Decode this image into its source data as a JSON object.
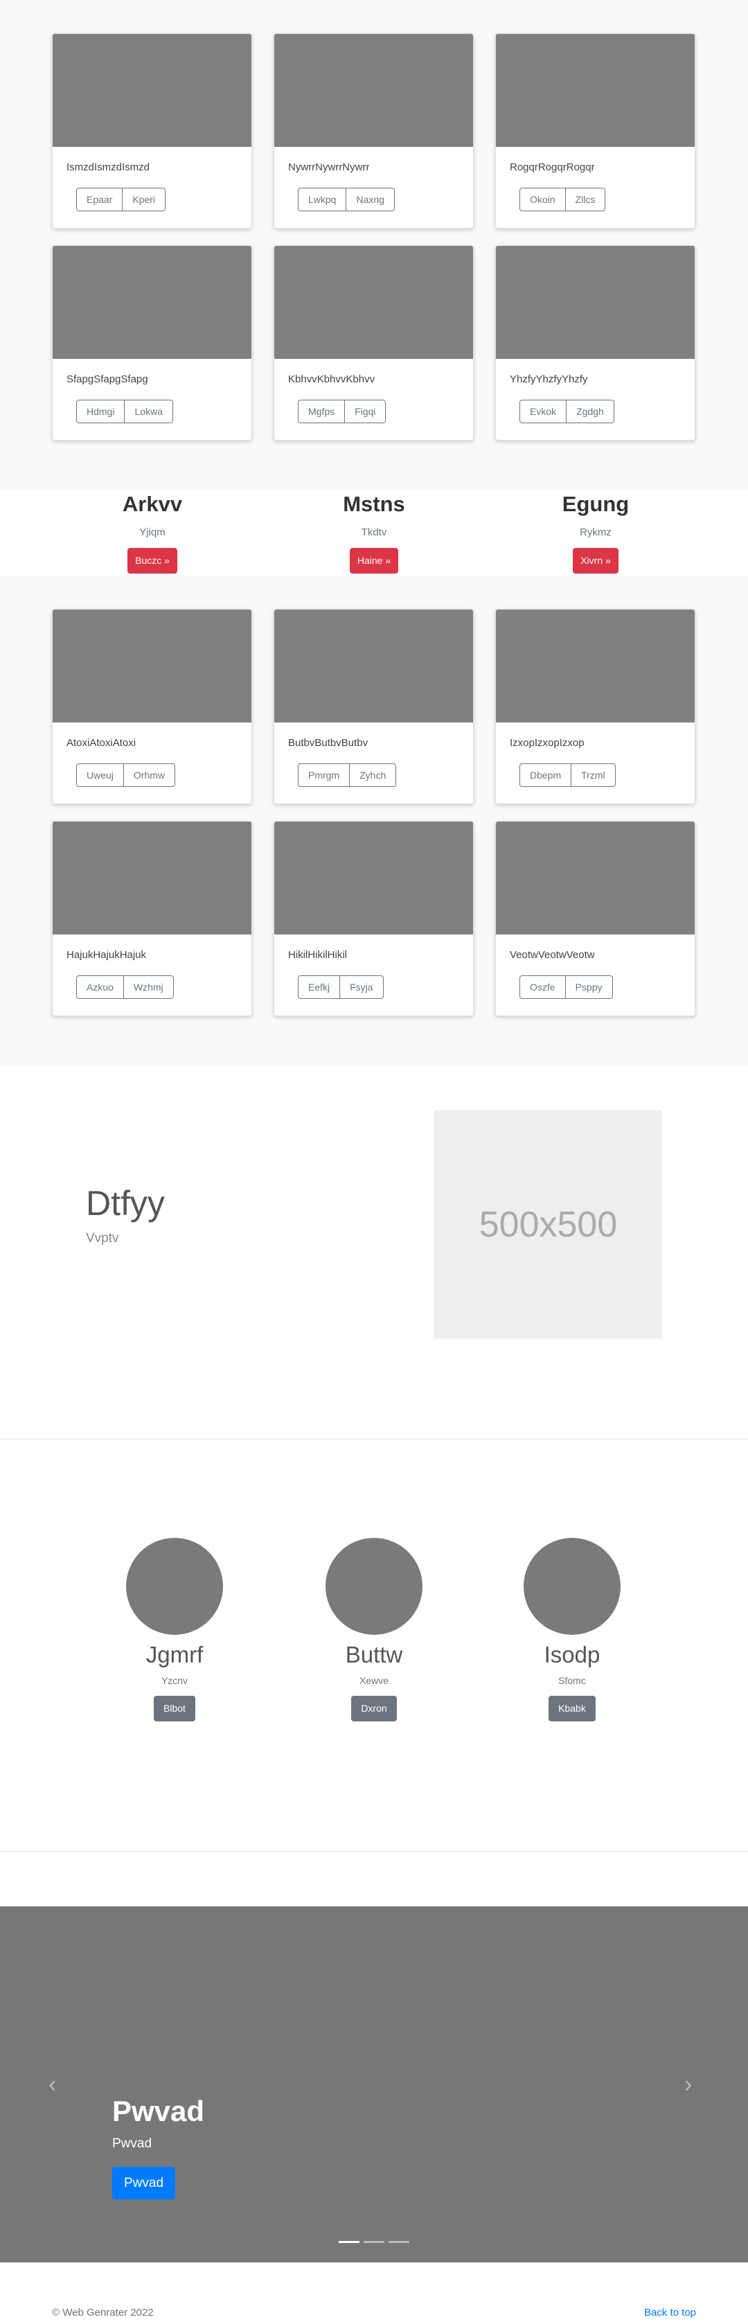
{
  "album1": {
    "cards": [
      {
        "text": "IsmzdIsmzdIsmzd",
        "btn1": "Epaar",
        "btn2": "Kperi"
      },
      {
        "text": "NywrrNywrrNywrr",
        "btn1": "Lwkpq",
        "btn2": "Naxng"
      },
      {
        "text": "RogqrRogqrRogqr",
        "btn1": "Okoin",
        "btn2": "Zllcs"
      },
      {
        "text": "SfapgSfapgSfapg",
        "btn1": "Hdmgi",
        "btn2": "Lokwa"
      },
      {
        "text": "KbhvvKbhvvKbhvv",
        "btn1": "Mgfps",
        "btn2": "Figqi"
      },
      {
        "text": "YhzfyYhzfyYhzfy",
        "btn1": "Evkok",
        "btn2": "Zgdgh"
      }
    ]
  },
  "teasers": [
    {
      "title": "Arkvv",
      "sub": "Yjiqm",
      "btn": "Buczc »"
    },
    {
      "title": "Mstns",
      "sub": "Tkdtv",
      "btn": "Haine »"
    },
    {
      "title": "Egung",
      "sub": "Rykmz",
      "btn": "Xivrn »"
    }
  ],
  "album2": {
    "cards": [
      {
        "text": "AtoxiAtoxiAtoxi",
        "btn1": "Uweuj",
        "btn2": "Orhmw"
      },
      {
        "text": "ButbvButbvButbv",
        "btn1": "Pmrgm",
        "btn2": "Zyhch"
      },
      {
        "text": "IzxopIzxopIzxop",
        "btn1": "Dbepm",
        "btn2": "Trzml"
      },
      {
        "text": "HajukHajukHajuk",
        "btn1": "Azkuo",
        "btn2": "Wzhmj"
      },
      {
        "text": "HikilHikilHikil",
        "btn1": "Eefkj",
        "btn2": "Fsyja"
      },
      {
        "text": "VeotwVeotwVeotw",
        "btn1": "Oszfe",
        "btn2": "Psppy"
      }
    ]
  },
  "feature": {
    "title": "Dtfyy",
    "sub": "Vvptv",
    "placeholder": "500x500"
  },
  "team": [
    {
      "name": "Jgmrf",
      "role": "Yzcnv",
      "btn": "Blbot"
    },
    {
      "name": "Buttw",
      "role": "Xewve",
      "btn": "Dxron"
    },
    {
      "name": "Isodp",
      "role": "Sfomc",
      "btn": "Kbabk"
    }
  ],
  "carousel": {
    "prev": "‹",
    "next": "›",
    "title": "Pwvad",
    "caption": "Pwvad",
    "btn": "Pwvad"
  },
  "footer": {
    "copy": "© Web Genrater 2022",
    "back_to_top": "Back to top"
  }
}
